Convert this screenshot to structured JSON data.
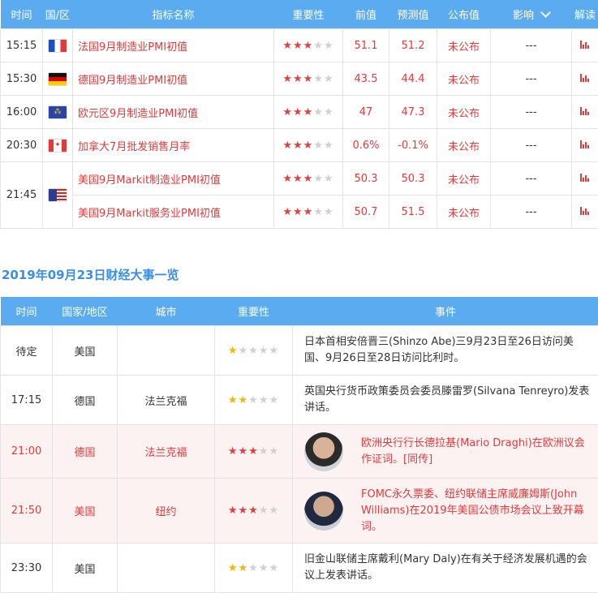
{
  "indicators": {
    "headers": {
      "time": "时间",
      "country": "国/区",
      "name": "指标名称",
      "importance": "重要性",
      "previous": "前值",
      "forecast": "预测值",
      "actual": "公布值",
      "impact": "影响",
      "analysis": "解读"
    },
    "rows": [
      {
        "time": "15:15",
        "flag": "france-flag",
        "name": "法国9月制造业PMI初值",
        "stars": 3,
        "previous": "51.1",
        "forecast": "51.2",
        "actual": "未公布",
        "impact": "---"
      },
      {
        "time": "15:30",
        "flag": "germany-flag",
        "name": "德国9月制造业PMI初值",
        "stars": 3,
        "previous": "43.5",
        "forecast": "44.4",
        "actual": "未公布",
        "impact": "---"
      },
      {
        "time": "16:00",
        "flag": "eu-flag",
        "name": "欧元区9月制造业PMI初值",
        "stars": 3,
        "previous": "47",
        "forecast": "47.3",
        "actual": "未公布",
        "impact": "---"
      },
      {
        "time": "20:30",
        "flag": "canada-flag",
        "name": "加拿大7月批发销售月率",
        "stars": 3,
        "previous": "0.6%",
        "forecast": "-0.1%",
        "actual": "未公布",
        "impact": "---"
      },
      {
        "time": "21:45",
        "flag": "usa-flag",
        "name": "美国9月Markit制造业PMI初值",
        "stars": 3,
        "previous": "50.3",
        "forecast": "50.3",
        "actual": "未公布",
        "impact": "---"
      },
      {
        "time": "",
        "flag": "",
        "name": "美国9月Markit服务业PMI初值",
        "stars": 3,
        "previous": "50.7",
        "forecast": "51.5",
        "actual": "未公布",
        "impact": "---"
      }
    ]
  },
  "events": {
    "title": "2019年09月23日财经大事一览",
    "headers": {
      "time": "时间",
      "country": "国家/地区",
      "city": "城市",
      "importance": "重要性",
      "event": "事件"
    },
    "rows": [
      {
        "time": "待定",
        "country": "美国",
        "city": "",
        "stars": 1,
        "text": "日本首相安倍晋三(Shinzo Abe)三9月23日至26日访问美国、9月26日至28日访问比利时。"
      },
      {
        "time": "17:15",
        "country": "德国",
        "city": "法兰克福",
        "stars": 2,
        "text": "英国央行货币政策委员会委员滕雷罗(Silvana Tenreyro)发表讲话。"
      },
      {
        "time": "21:00",
        "country": "德国",
        "city": "法兰克福",
        "stars": 3,
        "text": "欧洲央行行长德拉基(Mario Draghi)在欧洲议会作证词。[同传]"
      },
      {
        "time": "21:50",
        "country": "美国",
        "city": "纽约",
        "stars": 3,
        "text": "FOMC永久票委、纽约联储主席威廉姆斯(John Williams)在2019年美国公债市场会议上致开幕词。"
      },
      {
        "time": "23:30",
        "country": "美国",
        "city": "",
        "stars": 2,
        "text": "旧金山联储主席戴利(Mary Daly)在有关于经济发展机遇的会议上发表讲话。"
      }
    ]
  }
}
